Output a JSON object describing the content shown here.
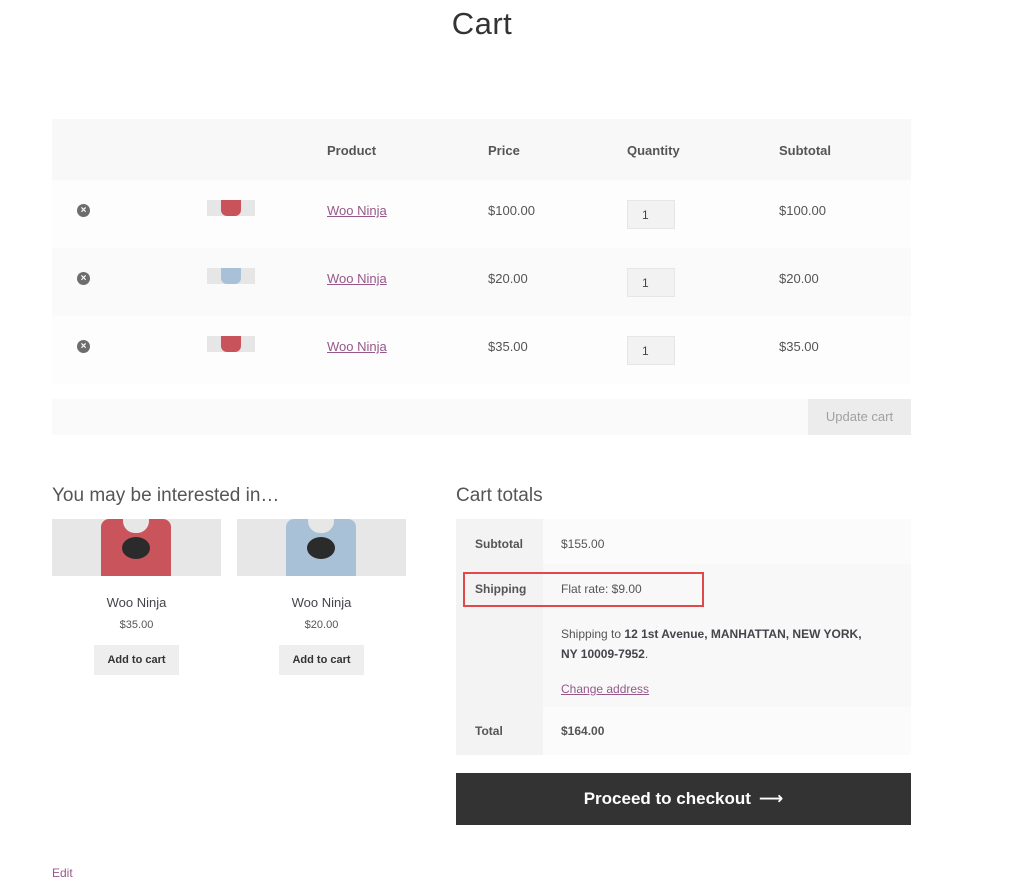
{
  "page": {
    "title": "Cart"
  },
  "cart": {
    "headers": {
      "product": "Product",
      "price": "Price",
      "quantity": "Quantity",
      "subtotal": "Subtotal"
    },
    "remove_glyph": "×",
    "items": [
      {
        "name": "Woo Ninja",
        "price": "$100.00",
        "quantity": "1",
        "subtotal": "$100.00",
        "color": "#c8535a"
      },
      {
        "name": "Woo Ninja",
        "price": "$20.00",
        "quantity": "1",
        "subtotal": "$20.00",
        "color": "#a8c0d8"
      },
      {
        "name": "Woo Ninja",
        "price": "$35.00",
        "quantity": "1",
        "subtotal": "$35.00",
        "color": "#c8535a"
      }
    ],
    "update_label": "Update cart"
  },
  "cross_sells": {
    "title": "You may be interested in…",
    "products": [
      {
        "name": "Woo Ninja",
        "price": "$35.00",
        "button": "Add to cart",
        "color": "#c9545c"
      },
      {
        "name": "Woo Ninja",
        "price": "$20.00",
        "button": "Add to cart",
        "color": "#a9c1d7"
      }
    ]
  },
  "totals": {
    "title": "Cart totals",
    "subtotal_label": "Subtotal",
    "subtotal_value": "$155.00",
    "shipping_label": "Shipping",
    "shipping_method": "Flat rate: $9.00",
    "shipping_to_prefix": "Shipping to ",
    "shipping_address": "12 1st Avenue, MANHATTAN, NEW YORK, NY 10009-7952",
    "shipping_to_suffix": ".",
    "change_address": "Change address",
    "total_label": "Total",
    "total_value": "$164.00"
  },
  "checkout": {
    "label": "Proceed to checkout",
    "arrow": "⟶"
  },
  "footer": {
    "edit": "Edit"
  },
  "colors": {
    "link": "#96588a",
    "highlight": "#e0494b",
    "checkout_bg": "#333333"
  }
}
